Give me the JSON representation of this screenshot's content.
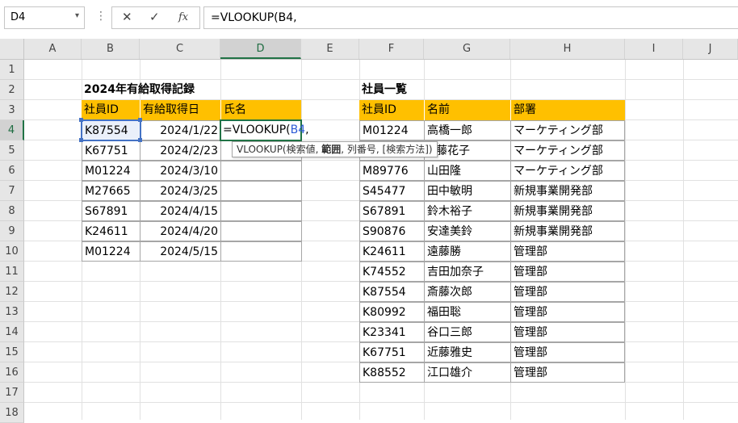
{
  "name_box": "D4",
  "formula_bar": {
    "cancel": "✕",
    "enter": "✓",
    "fx": "fx",
    "formula": "=VLOOKUP(B4,"
  },
  "columns": [
    "A",
    "B",
    "C",
    "D",
    "E",
    "F",
    "G",
    "H",
    "I",
    "J"
  ],
  "rows": [
    "1",
    "2",
    "3",
    "4",
    "5",
    "6",
    "7",
    "8",
    "9",
    "10",
    "11",
    "12",
    "13",
    "14",
    "15",
    "16",
    "17",
    "18"
  ],
  "left_table": {
    "title": "2024年有給取得記録",
    "headers": [
      "社員ID",
      "有給取得日",
      "氏名"
    ],
    "rows": [
      [
        "K87554",
        "2024/1/22"
      ],
      [
        "K67751",
        "2024/2/23"
      ],
      [
        "M01224",
        "2024/3/10"
      ],
      [
        "M27665",
        "2024/3/25"
      ],
      [
        "S67891",
        "2024/4/15"
      ],
      [
        "K24611",
        "2024/4/20"
      ],
      [
        "M01224",
        "2024/5/15"
      ]
    ],
    "editing_cell": {
      "prefix": "=VLOOKUP(",
      "ref": "B4",
      "suffix": ","
    }
  },
  "right_table": {
    "title": "社員一覧",
    "headers": [
      "社員ID",
      "名前",
      "部署"
    ],
    "rows": [
      [
        "M01224",
        "高橋一郎",
        "マーケティング部"
      ],
      [
        "",
        "藤花子",
        "マーケティング部"
      ],
      [
        "M89776",
        "山田隆",
        "マーケティング部"
      ],
      [
        "S45477",
        "田中敏明",
        "新規事業開発部"
      ],
      [
        "S67891",
        "鈴木裕子",
        "新規事業開発部"
      ],
      [
        "S90876",
        "安達美鈴",
        "新規事業開発部"
      ],
      [
        "K24611",
        "遠藤勝",
        "管理部"
      ],
      [
        "K74552",
        "吉田加奈子",
        "管理部"
      ],
      [
        "K87554",
        "斎藤次郎",
        "管理部"
      ],
      [
        "K80992",
        "福田聡",
        "管理部"
      ],
      [
        "K23341",
        "谷口三郎",
        "管理部"
      ],
      [
        "K67751",
        "近藤雅史",
        "管理部"
      ],
      [
        "K88552",
        "江口雄介",
        "管理部"
      ]
    ]
  },
  "tooltip": {
    "func": "VLOOKUP(",
    "arg1": "検索値",
    "sep1": ", ",
    "arg2": "範囲",
    "rest": ", 列番号, [検索方法])"
  },
  "colors": {
    "header_fill": "#ffc000",
    "active_border": "#217346",
    "ref_border": "#4472c4"
  }
}
